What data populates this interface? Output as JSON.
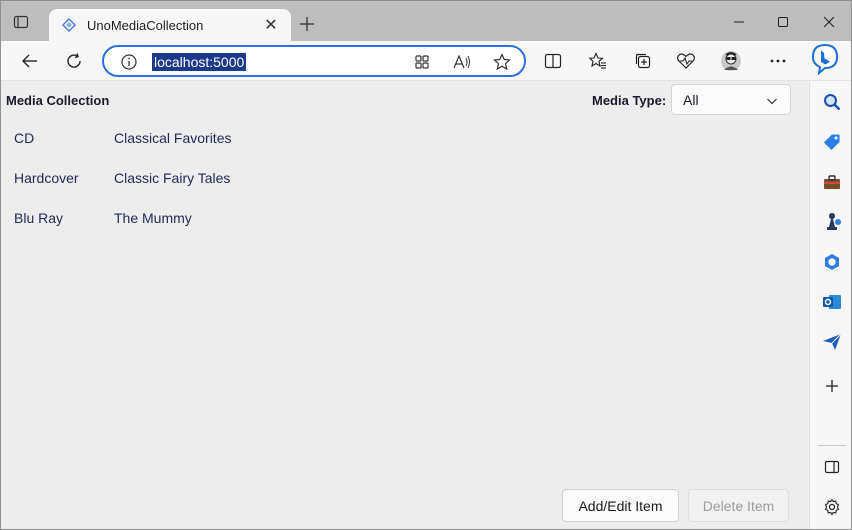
{
  "browser": {
    "tab": {
      "title": "UnoMediaCollection"
    },
    "address": {
      "url": "localhost:5000"
    }
  },
  "page": {
    "title": "Media Collection",
    "media_type_label": "Media Type:",
    "media_type_selected": "All",
    "items": [
      {
        "type": "CD",
        "title": "Classical Favorites"
      },
      {
        "type": "Hardcover",
        "title": "Classic Fairy Tales"
      },
      {
        "type": "Blu Ray",
        "title": "The Mummy"
      }
    ],
    "buttons": {
      "add_edit": "Add/Edit Item",
      "delete": "Delete Item"
    }
  },
  "colors": {
    "accent": "#2f6fde",
    "url_highlight": "#1b3a8c"
  }
}
